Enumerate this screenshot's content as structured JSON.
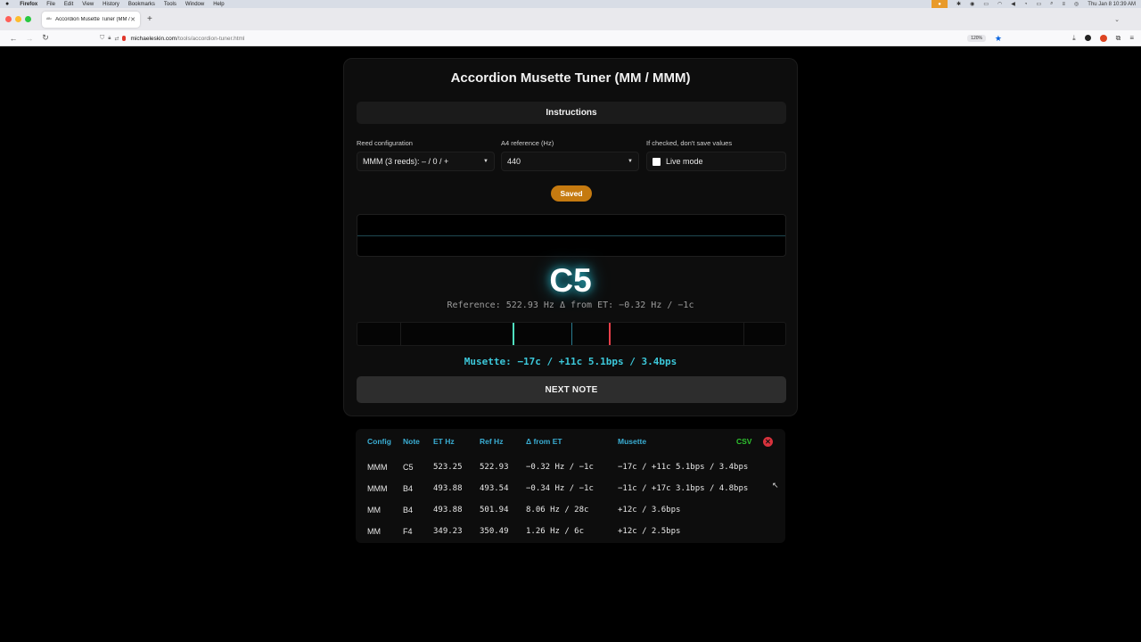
{
  "menubar": {
    "apple": "",
    "app_name": "Firefox",
    "items": [
      "File",
      "Edit",
      "View",
      "History",
      "Bookmarks",
      "Tools",
      "Window",
      "Help"
    ],
    "clock": "Thu Jan 8  10:39 AM"
  },
  "browser": {
    "tab_title": "Accordion Musette Tuner (MM / ",
    "url_host": "michaeleskin.com",
    "url_path": "/tools/accordion-tuner.html",
    "zoom": "120%"
  },
  "app": {
    "title": "Accordion Musette Tuner (MM / MMM)",
    "instructions_label": "Instructions",
    "reed_config_label": "Reed configuration",
    "reed_config_value": "MMM (3 reeds):  – / 0 / +",
    "a4_label": "A4 reference (Hz)",
    "a4_value": "440",
    "live_label": "If checked, don't save values",
    "live_mode_label": "Live mode",
    "live_mode_checked": false,
    "saved_badge": "Saved",
    "note": "C5",
    "reference_line": "Reference: 522.93 Hz  Δ from ET: −0.32 Hz / −1c",
    "musette_line": "Musette:  −17c / +11c  5.1bps / 3.4bps",
    "next_note_label": "NEXT NOTE",
    "meter_colors": {
      "low": "#4fe0c0",
      "center": "#2a7c90",
      "high": "#e8404a"
    }
  },
  "history": {
    "headers": {
      "config": "Config",
      "note": "Note",
      "et_hz": "ET Hz",
      "ref_hz": "Ref Hz",
      "delta": "Δ from ET",
      "musette": "Musette",
      "csv": "CSV",
      "clear": "✕"
    },
    "rows": [
      {
        "config": "MMM",
        "note": "C5",
        "et_hz": "523.25",
        "ref_hz": "522.93",
        "delta": "−0.32 Hz / −1c",
        "musette": "−17c / +11c  5.1bps / 3.4bps"
      },
      {
        "config": "MMM",
        "note": "B4",
        "et_hz": "493.88",
        "ref_hz": "493.54",
        "delta": "−0.34 Hz / −1c",
        "musette": "−11c / +17c  3.1bps / 4.8bps"
      },
      {
        "config": "MM",
        "note": "B4",
        "et_hz": "493.88",
        "ref_hz": "501.94",
        "delta": "8.06 Hz / 28c",
        "musette": "+12c / 3.6bps"
      },
      {
        "config": "MM",
        "note": "F4",
        "et_hz": "349.23",
        "ref_hz": "350.49",
        "delta": "1.26 Hz / 6c",
        "musette": "+12c / 2.5bps"
      }
    ]
  }
}
